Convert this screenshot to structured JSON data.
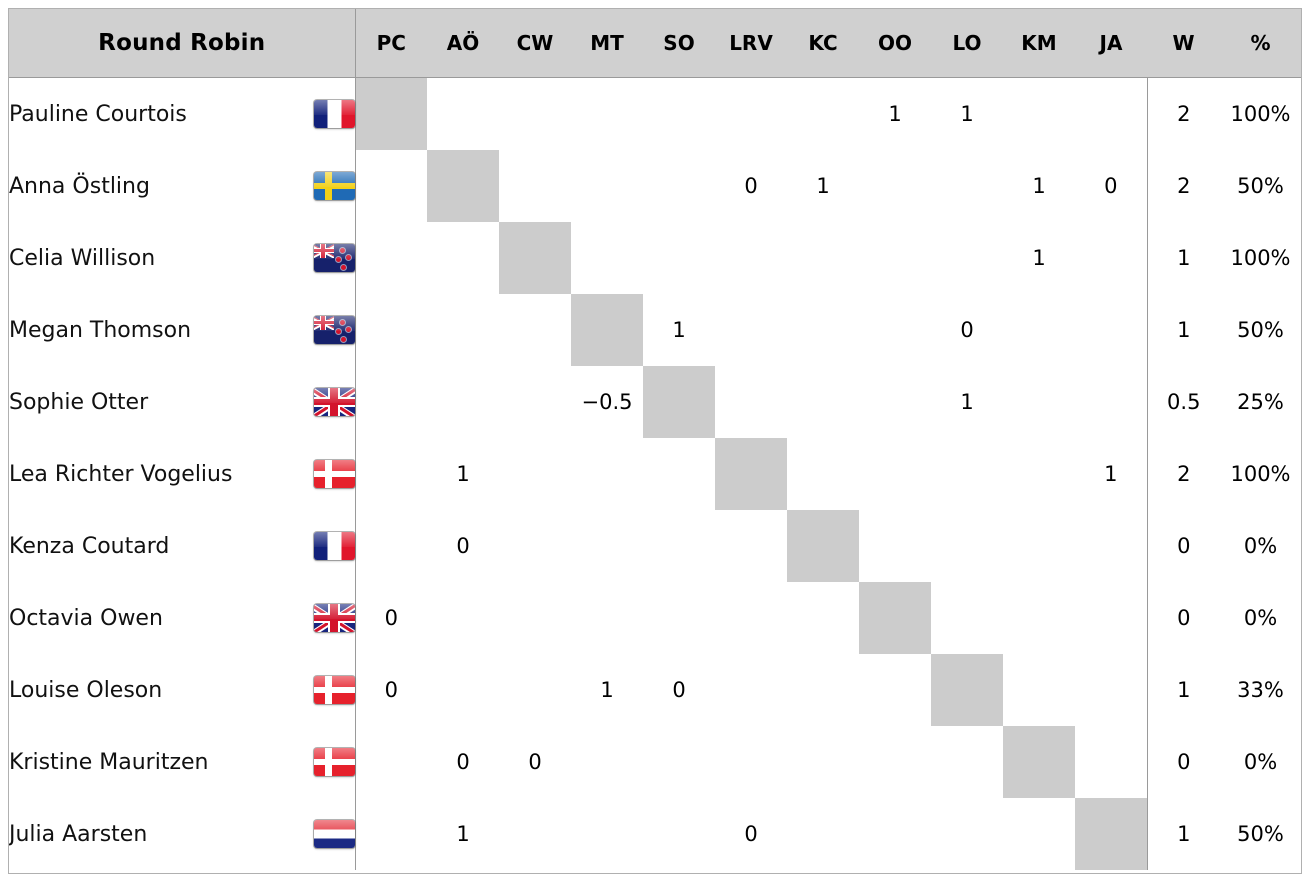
{
  "header": {
    "title": "Round Robin",
    "player_columns": [
      "PC",
      "AÖ",
      "CW",
      "MT",
      "SO",
      "LRV",
      "KC",
      "OO",
      "LO",
      "KM",
      "JA"
    ],
    "wins_label": "W",
    "percent_label": "%"
  },
  "colors": {
    "header_background": "#d0d0d0",
    "diagonal_cell": "#cccccc",
    "border": "#9a9a9a",
    "outer_border": "#b0b0b0",
    "text": "#000000"
  },
  "rows": [
    {
      "abbr": "PC",
      "name": "Pauline Courtois",
      "flag": "fr",
      "flag_name": "france-flag",
      "cells": [
        "",
        "",
        "",
        "",
        "",
        "",
        "",
        "1",
        "1",
        "",
        ""
      ],
      "wins": "2",
      "percent": "100%"
    },
    {
      "abbr": "AÖ",
      "name": "Anna Östling",
      "flag": "se",
      "flag_name": "sweden-flag",
      "cells": [
        "",
        "",
        "",
        "",
        "",
        "0",
        "1",
        "",
        "",
        "1",
        "0"
      ],
      "wins": "2",
      "percent": "50%"
    },
    {
      "abbr": "CW",
      "name": "Celia Willison",
      "flag": "nz",
      "flag_name": "new-zealand-flag",
      "cells": [
        "",
        "",
        "",
        "",
        "",
        "",
        "",
        "",
        "",
        "1",
        ""
      ],
      "wins": "1",
      "percent": "100%"
    },
    {
      "abbr": "MT",
      "name": "Megan Thomson",
      "flag": "nz",
      "flag_name": "new-zealand-flag",
      "cells": [
        "",
        "",
        "",
        "",
        "1",
        "",
        "",
        "",
        "0",
        "",
        ""
      ],
      "wins": "1",
      "percent": "50%"
    },
    {
      "abbr": "SO",
      "name": "Sophie Otter",
      "flag": "gb",
      "flag_name": "united-kingdom-flag",
      "cells": [
        "",
        "",
        "",
        "−0.5",
        "",
        "",
        "",
        "",
        "1",
        "",
        ""
      ],
      "wins": "0.5",
      "percent": "25%"
    },
    {
      "abbr": "LRV",
      "name": "Lea Richter Vogelius",
      "flag": "dk",
      "flag_name": "denmark-flag",
      "cells": [
        "",
        "1",
        "",
        "",
        "",
        "",
        "",
        "",
        "",
        "",
        "1"
      ],
      "wins": "2",
      "percent": "100%"
    },
    {
      "abbr": "KC",
      "name": "Kenza Coutard",
      "flag": "fr",
      "flag_name": "france-flag",
      "cells": [
        "",
        "0",
        "",
        "",
        "",
        "",
        "",
        "",
        "",
        "",
        ""
      ],
      "wins": "0",
      "percent": "0%"
    },
    {
      "abbr": "OO",
      "name": "Octavia Owen",
      "flag": "gb",
      "flag_name": "united-kingdom-flag",
      "cells": [
        "0",
        "",
        "",
        "",
        "",
        "",
        "",
        "",
        "",
        "",
        ""
      ],
      "wins": "0",
      "percent": "0%"
    },
    {
      "abbr": "LO",
      "name": "Louise Oleson",
      "flag": "dk",
      "flag_name": "denmark-flag",
      "cells": [
        "0",
        "",
        "",
        "1",
        "0",
        "",
        "",
        "",
        "",
        "",
        ""
      ],
      "wins": "1",
      "percent": "33%"
    },
    {
      "abbr": "KM",
      "name": "Kristine Mauritzen",
      "flag": "dk",
      "flag_name": "denmark-flag",
      "cells": [
        "",
        "0",
        "0",
        "",
        "",
        "",
        "",
        "",
        "",
        "",
        ""
      ],
      "wins": "0",
      "percent": "0%"
    },
    {
      "abbr": "JA",
      "name": "Julia Aarsten",
      "flag": "nl",
      "flag_name": "netherlands-flag",
      "cells": [
        "",
        "1",
        "",
        "",
        "",
        "0",
        "",
        "",
        "",
        "",
        ""
      ],
      "wins": "1",
      "percent": "50%"
    }
  ]
}
